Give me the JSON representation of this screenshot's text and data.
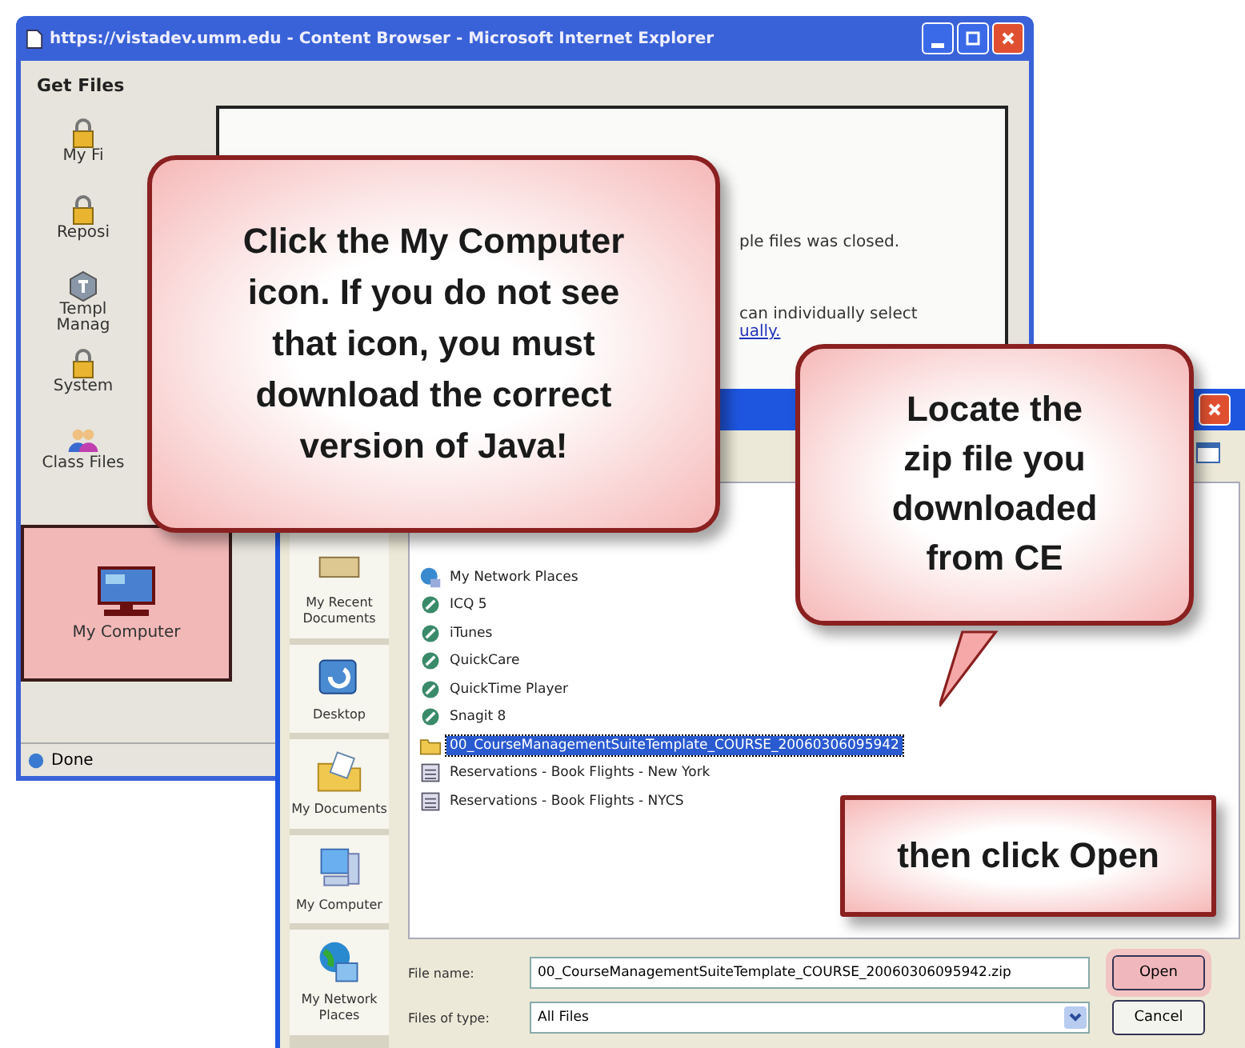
{
  "browser_window": {
    "title": "https://vistadev.umm.edu - Content Browser - Microsoft Internet Explorer",
    "heading": "Get Files",
    "sidebar_items": [
      {
        "label": "My Fi",
        "kind": "lock",
        "selected": false
      },
      {
        "label": "Reposi",
        "kind": "lock",
        "selected": false
      },
      {
        "label": "Templ\nManag",
        "kind": "template",
        "selected": false
      },
      {
        "label": "System",
        "kind": "lock",
        "selected": false
      },
      {
        "label": "Class Files",
        "kind": "people",
        "selected": false
      },
      {
        "label": "My Computer",
        "kind": "computer",
        "selected": true
      }
    ],
    "content_lines": [
      "ple files was closed.",
      "can individually select"
    ],
    "link": "ually.",
    "status": "Done"
  },
  "file_dialog": {
    "places": [
      {
        "label": "My Recent Documents",
        "kind": "recent"
      },
      {
        "label": "Desktop",
        "kind": "desktop"
      },
      {
        "label": "My Documents",
        "kind": "documents"
      },
      {
        "label": "My Computer",
        "kind": "computer"
      },
      {
        "label": "My Network Places",
        "kind": "network"
      }
    ],
    "files": [
      {
        "name": "My Network Places",
        "kind": "network",
        "selected": false
      },
      {
        "name": "ICQ 5",
        "kind": "app",
        "selected": false
      },
      {
        "name": "iTunes",
        "kind": "app",
        "selected": false
      },
      {
        "name": "QuickCare",
        "kind": "app",
        "selected": false
      },
      {
        "name": "QuickTime Player",
        "kind": "app",
        "selected": false
      },
      {
        "name": "Snagit 8",
        "kind": "app",
        "selected": false
      },
      {
        "name": "00_CourseManagementSuiteTemplate_COURSE_20060306095942",
        "kind": "folder",
        "selected": true
      },
      {
        "name": "Reservations - Book Flights - New York",
        "kind": "file",
        "selected": false
      },
      {
        "name": "Reservations - Book Flights - NYCS",
        "kind": "file",
        "selected": false
      }
    ],
    "file_name_label": "File name:",
    "file_name": "00_CourseManagementSuiteTemplate_COURSE_20060306095942.zip",
    "file_type_label": "Files of type:",
    "file_type": "All Files",
    "buttons": [
      {
        "label": "Open",
        "highlighted": true
      },
      {
        "label": "Cancel",
        "highlighted": false
      }
    ]
  },
  "callouts": [
    {
      "text": "Click the My Computer icon. If you do not see that icon, you must download the correct version of Java!",
      "kind": "box"
    },
    {
      "text": "Locate the zip file you downloaded from CE",
      "kind": "speech"
    },
    {
      "text": "then click Open",
      "kind": "box"
    }
  ]
}
